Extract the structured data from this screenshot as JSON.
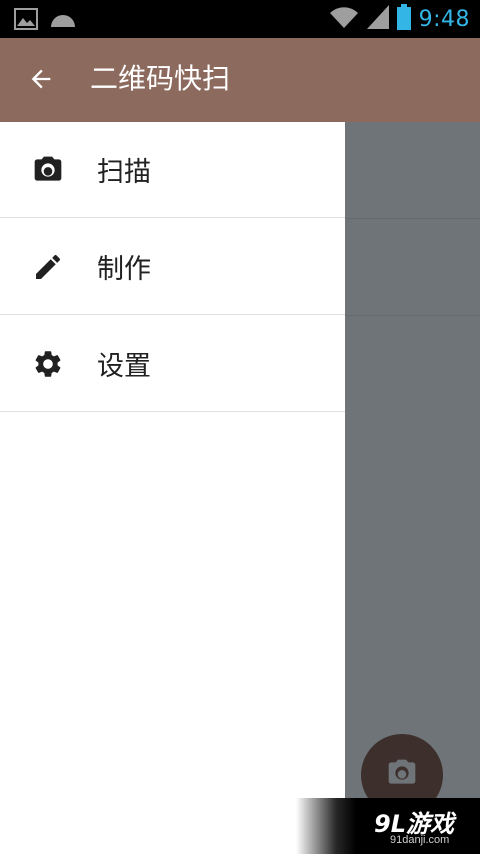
{
  "status_bar": {
    "time": "9:48",
    "icons": [
      "image-icon",
      "android-icon",
      "wifi-icon",
      "signal-icon",
      "battery-icon"
    ]
  },
  "app_bar": {
    "title": "二维码快扫",
    "back_icon": "arrow-back-icon"
  },
  "drawer": {
    "items": [
      {
        "label": "扫描",
        "icon": "camera-icon"
      },
      {
        "label": "制作",
        "icon": "pencil-icon"
      },
      {
        "label": "设置",
        "icon": "gear-icon"
      }
    ]
  },
  "fab": {
    "icon": "camera-icon"
  },
  "watermark": {
    "big": "9L游戏",
    "small": "91danji.com"
  },
  "colors": {
    "app_bar": "#8d6a5e",
    "status_accent": "#33b5e5",
    "scrim": "#6f7479",
    "fab": "#3c2f2c"
  }
}
